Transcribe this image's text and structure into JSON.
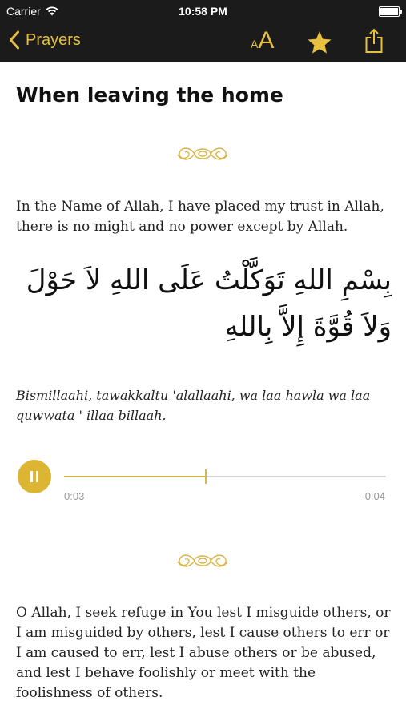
{
  "status_bar": {
    "carrier": "Carrier",
    "time": "10:58 PM",
    "battery_level": 1.0
  },
  "nav": {
    "back_label": "Prayers",
    "back_icon": "chevron-left-icon",
    "font_size_small": "A",
    "font_size_big": "A",
    "favorite_icon": "star-icon",
    "share_icon": "share-icon"
  },
  "colors": {
    "accent": "#e6c03e",
    "bar_background": "#1b1b1b",
    "player_button": "#dcb532",
    "track": "#d4d4d4"
  },
  "content": {
    "title": "When leaving the home",
    "sections": [
      {
        "translation": "In the Name of Allah, I have placed my trust in Allah, there is no might and no power except by Allah.",
        "arabic": "بِسْمِ اللهِ تَوَكَّلْتُ عَلَى اللهِ لاَ حَوْلَ وَلاَ قُوَّةَ إِلاَّ بِاللهِ",
        "transliteration": "Bismillaahi, tawakkaltu 'alallaahi, wa laa hawla wa laa quwwata ' illaa billaah.",
        "audio": {
          "elapsed": "0:03",
          "remaining": "-0:04",
          "progress": 0.44,
          "state": "playing"
        }
      },
      {
        "translation": "O Allah, I seek refuge in You lest I misguide others, or I am misguided by others, lest I cause others to err or I am caused to err, lest I abuse others or be abused, and lest I behave foolishly or meet with the foolishness of others."
      }
    ]
  }
}
